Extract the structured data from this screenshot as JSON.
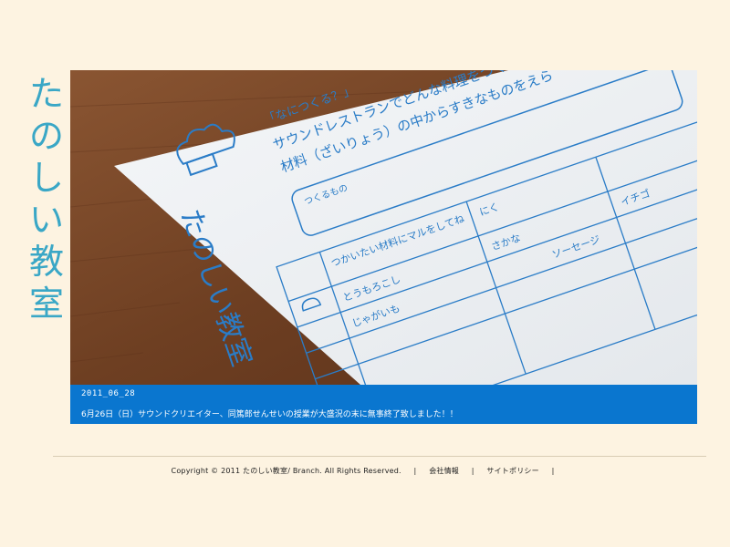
{
  "logo": {
    "chars": [
      "た",
      "の",
      "し",
      "い",
      "教",
      "室"
    ]
  },
  "hero": {
    "sheet_heading": "「なにつくる？」",
    "sheet_line1": "サウンドレストランでどんな料理をつくる",
    "sheet_line2": "材料（ざいりょう）の中からすきなものをえら",
    "sheet_logo": "たのしい教室",
    "field_label": "つくるもの",
    "list_header": "つかいたい材料にマルをしてね",
    "col_niku": "にく",
    "col_sakana": "さかな",
    "item_sausage": "ソーセージ",
    "item_ichigo": "イチゴ",
    "item_corn": "とうもろこし",
    "item_potato": "じゃがいも"
  },
  "caption": {
    "date": "2011_06_28",
    "message": "6月26日（日）サウンドクリエイター、同篤郎せんせいの授業が大盛況の末に無事終了致しました！！"
  },
  "footer": {
    "copyright": "Copyright © 2011 たのしい教室/ Branch. All Rights Reserved.",
    "sep": "|",
    "link_company": "会社情報",
    "link_policy": "サイトポリシー"
  },
  "colors": {
    "accent": "#0a76cf",
    "logo": "#3aa7c6",
    "background": "#fdf3e1"
  }
}
